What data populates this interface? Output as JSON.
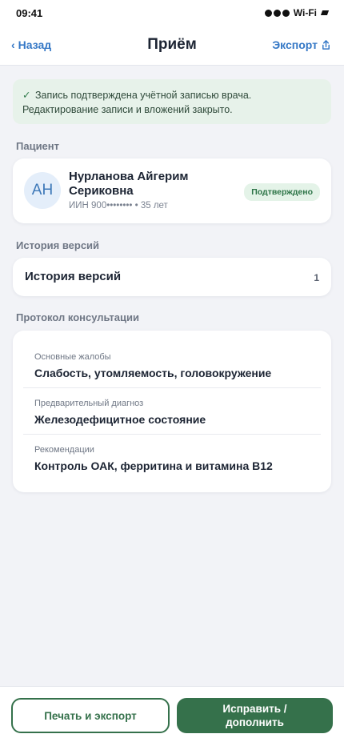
{
  "status_bar": {
    "time": "09:41",
    "network": "Wi-Fi"
  },
  "nav": {
    "back_label": "Назад",
    "title": "Приём",
    "export_label": "Экспорт"
  },
  "notice": {
    "line1": "Запись подтверждена учётной записью врача.",
    "line2": "Редактирование записи и вложений закрыто."
  },
  "patient": {
    "section_label": "Пациент",
    "initials": "АН",
    "name": "Нурланова Айгерим Сериковна",
    "meta": "ИИН 900•••••••• • 35 лет",
    "status": "Подтверждено"
  },
  "history": {
    "section_label": "История версий",
    "title": "История версий",
    "count": "1"
  },
  "protocol": {
    "section_label": "Протокол консультации",
    "fields": [
      {
        "label": "Основные жалобы",
        "value": "Слабость, утомляемость, головокружение"
      },
      {
        "label": "Предварительный диагноз",
        "value": "Железодефицитное состояние"
      },
      {
        "label": "Рекомендации",
        "value": "Контроль ОАК, ферритина и витамина B12"
      }
    ]
  },
  "actions": {
    "print_label": "Печать и экспорт",
    "fix_label": "Исправить / дополнить"
  },
  "colors": {
    "accent_green": "#35714b",
    "link_blue": "#3578c6",
    "notice_bg": "#e7f2ea"
  }
}
